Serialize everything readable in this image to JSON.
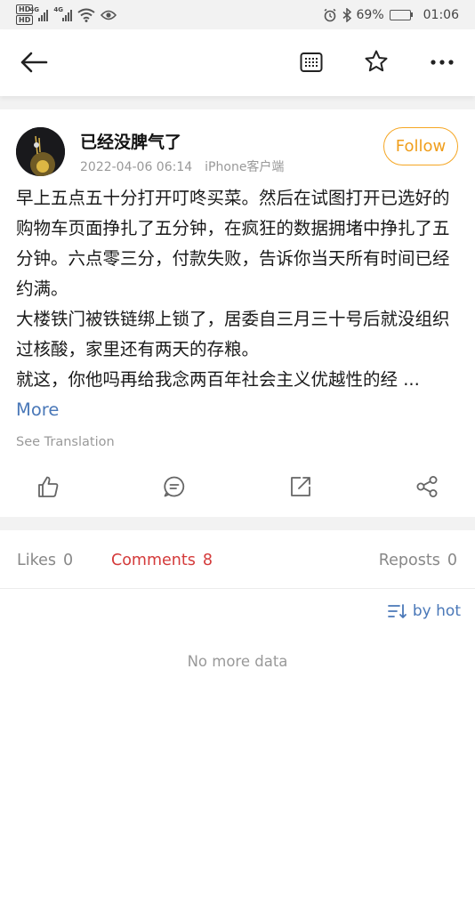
{
  "status_bar": {
    "hd1": "HD",
    "hd2": "HD",
    "net1": "4G",
    "net2": "4G",
    "battery_text": "69%",
    "battery_level": 0.69,
    "time": "01:06"
  },
  "post": {
    "author": "已经没脾气了",
    "date": "2022-04-06 06:14",
    "source": "iPhone客户端",
    "follow_label": "Follow",
    "paragraphs": [
      "早上五点五十分打开叮咚买菜。然后在试图打开已选好的购物车页面挣扎了五分钟，在疯狂的数据拥堵中挣扎了五分钟。六点零三分，付款失败，告诉你当天所有时间已经约满。",
      "大楼铁门被铁链绑上锁了，居委自三月三十号后就没组织过核酸，家里还有两天的存粮。"
    ],
    "last_text": "就这，你他吗再给我念两百年社会主义优越性的经",
    "ellipsis": " ... ",
    "more_label": "More",
    "translate_label": "See Translation"
  },
  "tabs": {
    "likes_label": "Likes",
    "likes_count": "0",
    "comments_label": "Comments",
    "comments_count": "8",
    "reposts_label": "Reposts",
    "reposts_count": "0"
  },
  "comments": {
    "sort_label": "by hot",
    "empty_text": "No more data"
  },
  "colors": {
    "follow": "#f09e1c",
    "active_tab": "#d43a3a",
    "link": "#4a78b8"
  }
}
